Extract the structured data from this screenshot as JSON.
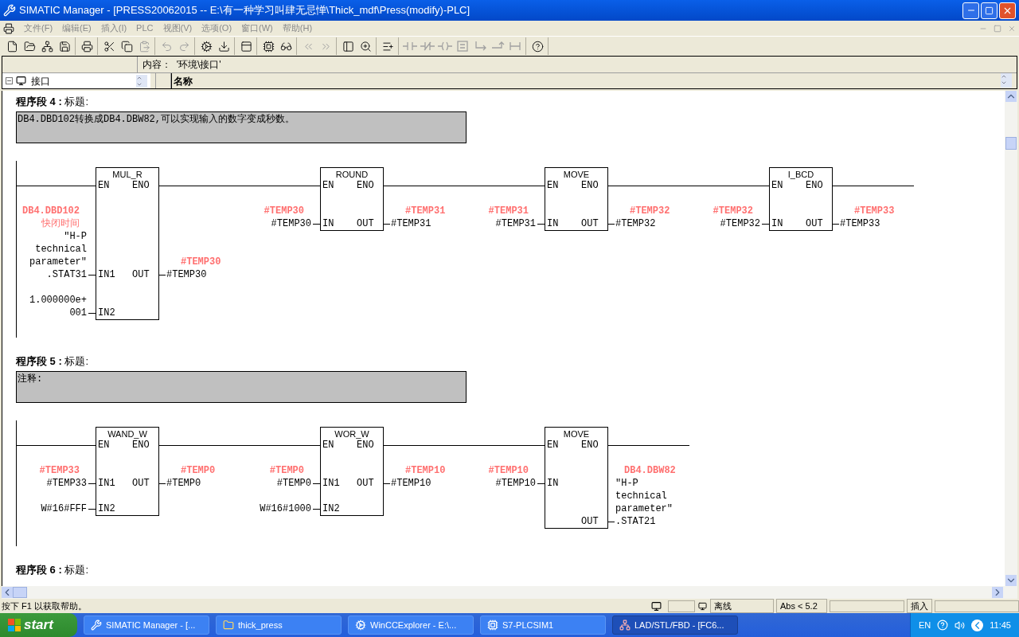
{
  "window": {
    "title": "SIMATIC Manager - [PRESS20062015 -- E:\\有一种学习叫肆无忌惮\\Thick_mdf\\Press(modify)-PLC]"
  },
  "menu": [
    "文件(F)",
    "编辑(E)",
    "插入(I)",
    "PLC",
    "视图(V)",
    "选项(O)",
    "窗口(W)",
    "帮助(H)"
  ],
  "toolbar": [
    [
      {
        "kind": "new",
        "disabled": false
      },
      {
        "kind": "open",
        "disabled": false
      },
      {
        "kind": "network",
        "disabled": false
      },
      {
        "kind": "save",
        "disabled": false
      }
    ],
    [
      {
        "kind": "print",
        "disabled": false
      }
    ],
    [
      {
        "kind": "cut",
        "disabled": false
      },
      {
        "kind": "copy",
        "disabled": false
      },
      {
        "kind": "paste",
        "disabled": true
      }
    ],
    [
      {
        "kind": "undo",
        "disabled": true
      },
      {
        "kind": "redo",
        "disabled": true
      }
    ],
    [
      {
        "kind": "compile",
        "disabled": false
      },
      {
        "kind": "download",
        "disabled": false
      }
    ],
    [
      {
        "kind": "interface",
        "disabled": false
      }
    ],
    [
      {
        "kind": "modules",
        "disabled": false
      },
      {
        "kind": "monitor",
        "disabled": false
      }
    ],
    [
      {
        "kind": "prev",
        "disabled": true
      },
      {
        "kind": "next",
        "disabled": true
      }
    ],
    [
      {
        "kind": "overview",
        "disabled": false
      },
      {
        "kind": "zoom",
        "disabled": false
      }
    ],
    [
      {
        "kind": "new-network",
        "disabled": false
      }
    ],
    [
      {
        "kind": "contact",
        "disabled": true
      },
      {
        "kind": "nc-contact",
        "disabled": true
      },
      {
        "kind": "coil",
        "disabled": true
      },
      {
        "kind": "empty-box",
        "disabled": true
      },
      {
        "kind": "branch-open",
        "disabled": true
      },
      {
        "kind": "branch-close",
        "disabled": true
      },
      {
        "kind": "connect",
        "disabled": true
      }
    ],
    [
      {
        "kind": "help",
        "disabled": false
      }
    ]
  ],
  "interface": {
    "content_label": "内容：  '环境\\接口'",
    "tree_item": "接口",
    "column_header": "名称"
  },
  "networks": [
    {
      "header": "**程序段 4 :** 标题:",
      "comment": "DB4.DBD102转换成DB4.DBW82,可以实现输入的数字变成秒数。",
      "blocks": [
        {
          "name": "MUL_R",
          "en": "EN",
          "eno": "ENO",
          "inputs": [
            {
              "pin": "IN1",
              "symbol": [
                "**DB4.DBD102**",
                "快闭时间"
              ],
              "operand": [
                "″H-P",
                "technical",
                "parameter″",
                ".STAT31"
              ]
            },
            {
              "pin": "IN2",
              "operand": [
                "1.000000e+",
                "001"
              ]
            }
          ],
          "outputs": [
            {
              "pin": "OUT",
              "symbol": [
                "#TEMP30"
              ],
              "operand": [
                "#TEMP30"
              ]
            }
          ]
        },
        {
          "name": "ROUND",
          "en": "EN",
          "eno": "ENO",
          "inputs": [
            {
              "pin": "IN",
              "symbol": [
                "#TEMP30"
              ],
              "operand": [
                "#TEMP30"
              ]
            }
          ],
          "outputs": [
            {
              "pin": "OUT",
              "symbol": [
                "#TEMP31"
              ],
              "operand": [
                "#TEMP31"
              ]
            }
          ]
        },
        {
          "name": "MOVE",
          "en": "EN",
          "eno": "ENO",
          "inputs": [
            {
              "pin": "IN",
              "symbol": [
                "#TEMP31"
              ],
              "operand": [
                "#TEMP31"
              ]
            }
          ],
          "outputs": [
            {
              "pin": "OUT",
              "symbol": [
                "#TEMP32"
              ],
              "operand": [
                "#TEMP32"
              ]
            }
          ]
        },
        {
          "name": "I_BCD",
          "en": "EN",
          "eno": "ENO",
          "inputs": [
            {
              "pin": "IN",
              "symbol": [
                "#TEMP32"
              ],
              "operand": [
                "#TEMP32"
              ]
            }
          ],
          "outputs": [
            {
              "pin": "OUT",
              "symbol": [
                "#TEMP33"
              ],
              "operand": [
                "#TEMP33"
              ]
            }
          ]
        }
      ]
    },
    {
      "header": "**程序段 5 :** 标题:",
      "comment": "注释:",
      "blocks": [
        {
          "name": "WAND_W",
          "en": "EN",
          "eno": "ENO",
          "inputs": [
            {
              "pin": "IN1",
              "symbol": [
                "#TEMP33"
              ],
              "operand": [
                "#TEMP33"
              ]
            },
            {
              "pin": "IN2",
              "operand": [
                "W#16#FFF"
              ]
            }
          ],
          "outputs": [
            {
              "pin": "OUT",
              "symbol": [
                "#TEMP0"
              ],
              "operand": [
                "#TEMP0"
              ]
            }
          ]
        },
        {
          "name": "WOR_W",
          "en": "EN",
          "eno": "ENO",
          "inputs": [
            {
              "pin": "IN1",
              "symbol": [
                "#TEMP0"
              ],
              "operand": [
                "#TEMP0"
              ]
            },
            {
              "pin": "IN2",
              "operand": [
                "W#16#1000"
              ]
            }
          ],
          "outputs": [
            {
              "pin": "OUT",
              "symbol": [
                "#TEMP10"
              ],
              "operand": [
                "#TEMP10"
              ]
            }
          ]
        },
        {
          "name": "MOVE",
          "en": "EN",
          "eno": "ENO",
          "inputs": [
            {
              "pin": "IN",
              "symbol": [
                "#TEMP10"
              ],
              "operand": [
                "#TEMP10"
              ]
            }
          ],
          "outputs": [
            {
              "pin": "OUT",
              "symbol": [
                "DB4.DBW82"
              ],
              "operand": [
                "″H-P",
                "technical",
                "parameter″",
                ".STAT21"
              ]
            }
          ]
        }
      ]
    },
    {
      "header": "**程序段 6 :** 标题:"
    }
  ],
  "status_bar": {
    "hint": "按下 F1 以获取帮助。",
    "mode": "离线",
    "version": "Abs < 5.2",
    "insert": "插入"
  },
  "taskbar": {
    "start": "start",
    "tasks": [
      {
        "kind": "simatic",
        "label": "SIMATIC Manager - [...",
        "selected": false
      },
      {
        "kind": "folder",
        "label": "thick_press",
        "selected": false
      },
      {
        "kind": "wincc",
        "label": "WinCCExplorer - E:\\...",
        "selected": false
      },
      {
        "kind": "plcsim",
        "label": "S7-PLCSIM1",
        "selected": false
      },
      {
        "kind": "lad",
        "label": "LAD/STL/FBD  - [FC6...",
        "selected": true
      }
    ],
    "language": "EN",
    "clock": "11:45"
  }
}
